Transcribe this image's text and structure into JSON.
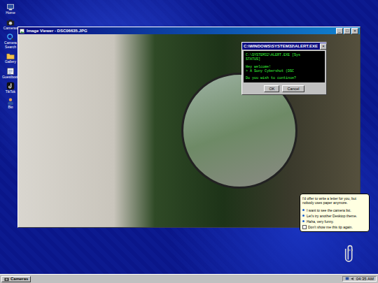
{
  "desktop_icons": [
    {
      "label": "Home"
    },
    {
      "label": "Cameras"
    },
    {
      "label": "Camera Search"
    },
    {
      "label": "Gallery"
    },
    {
      "label": "Guestbook"
    },
    {
      "label": "TikTok"
    },
    {
      "label": "Bio"
    }
  ],
  "image_viewer": {
    "title": "Image Viewer - DSC06635.JPG",
    "controls": [
      "_",
      "□",
      "×"
    ]
  },
  "alert": {
    "title": "C:\\WINDOWS\\SYSTEM32\\ALERT.EXE",
    "close": "×",
    "lines": [
      "C:\\SYSTEM32\\ALERT.EXE [Sys",
      "STATUS]",
      "Hey welcome!",
      "> A Sony Cybershot (DSC",
      "Do you wish to continue?"
    ],
    "buttons": [
      "OK",
      "Cancel"
    ]
  },
  "assistant": {
    "message": "I'd offer to write a letter for you, but nobody uses paper anymore.",
    "options": [
      "I want to see the camera list.",
      "Let's try another Desktop theme.",
      "Haha, very funny."
    ],
    "checkbox": {
      "label": "Don't show me this tip again.",
      "checked": false
    }
  },
  "taskbar": {
    "start": "Cameras",
    "clock": "04:35 AM"
  }
}
